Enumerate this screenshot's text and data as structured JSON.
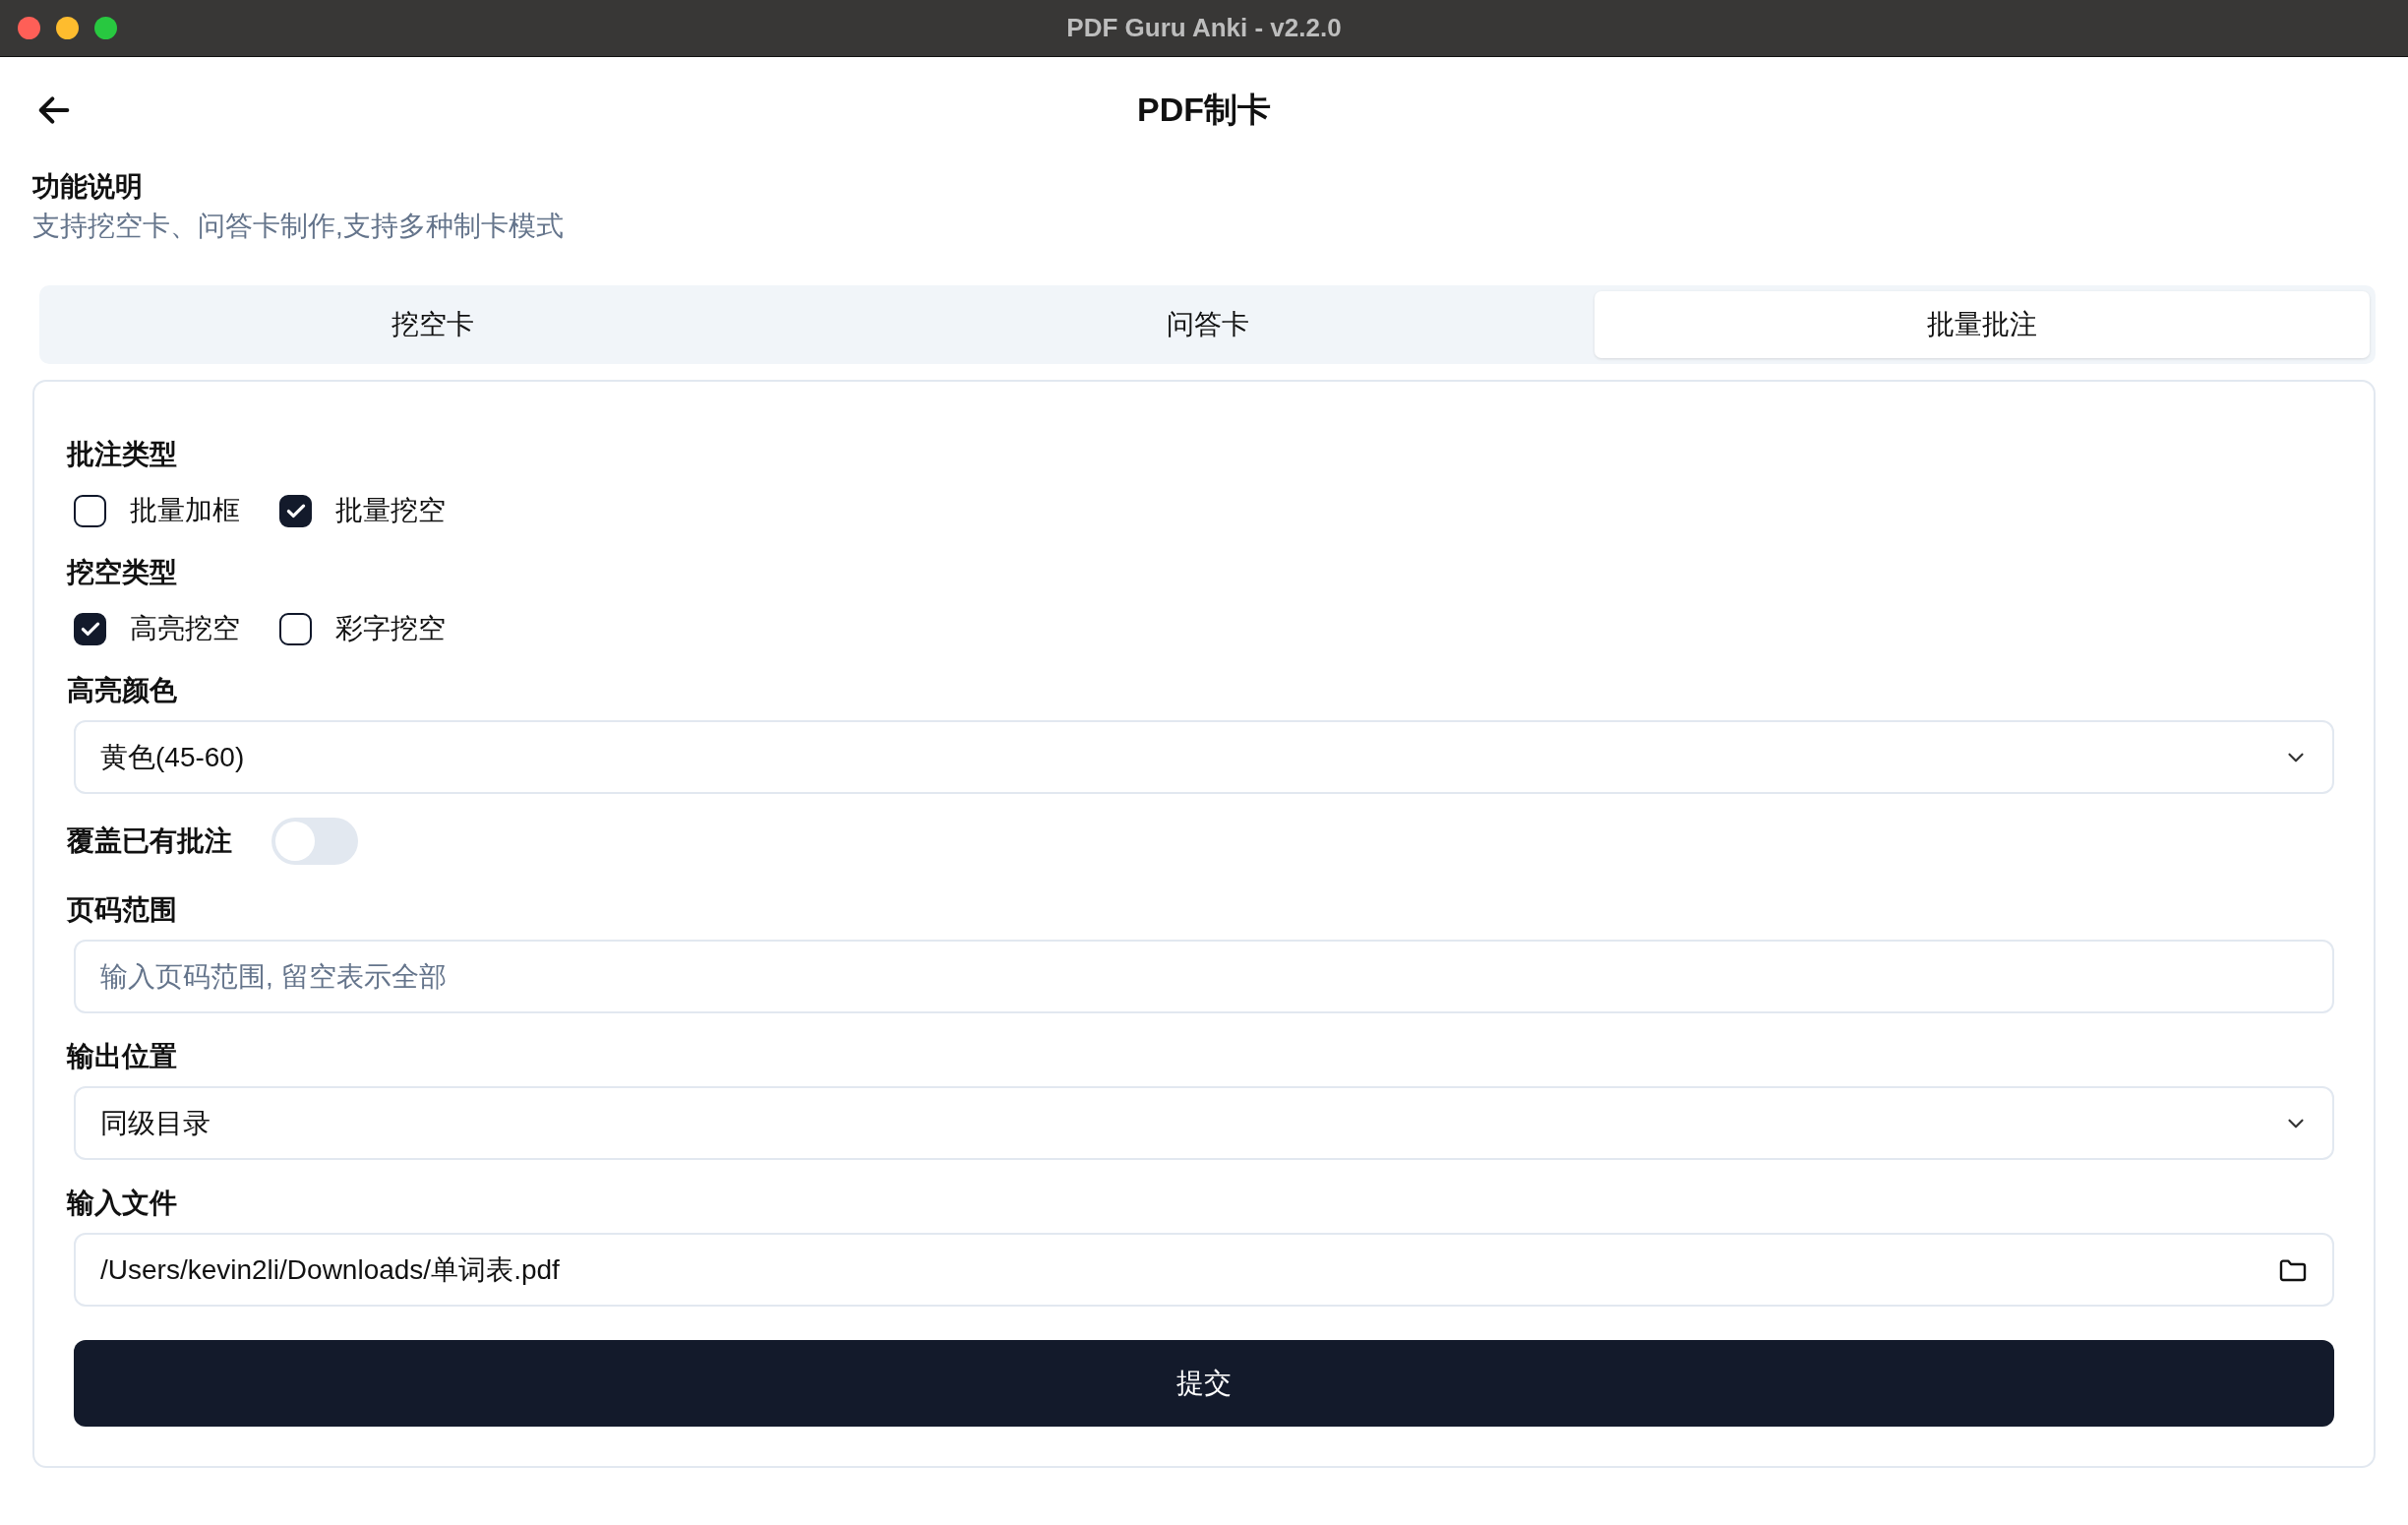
{
  "window": {
    "title": "PDF Guru Anki - v2.2.0"
  },
  "header": {
    "title": "PDF制卡"
  },
  "description": {
    "heading": "功能说明",
    "text": "支持挖空卡、问答卡制作,支持多种制卡模式"
  },
  "tabs": [
    {
      "label": "挖空卡",
      "selected": false
    },
    {
      "label": "问答卡",
      "selected": false
    },
    {
      "label": "批量批注",
      "selected": true
    }
  ],
  "form": {
    "fields": [
      {
        "kind": "checkgroup",
        "label": "批注类型",
        "options": [
          {
            "label": "批量加框",
            "checked": false
          },
          {
            "label": "批量挖空",
            "checked": true
          }
        ]
      },
      {
        "kind": "checkgroup",
        "label": "挖空类型",
        "options": [
          {
            "label": "高亮挖空",
            "checked": true
          },
          {
            "label": "彩字挖空",
            "checked": false
          }
        ]
      },
      {
        "kind": "select",
        "label": "高亮颜色",
        "value": "黄色(45-60)"
      },
      {
        "kind": "toggle",
        "label": "覆盖已有批注",
        "on": false
      },
      {
        "kind": "input",
        "label": "页码范围",
        "placeholder": "输入页码范围, 留空表示全部"
      },
      {
        "kind": "select",
        "label": "输出位置",
        "value": "同级目录"
      },
      {
        "kind": "file",
        "label": "输入文件",
        "value": "/Users/kevin2li/Downloads/单词表.pdf"
      }
    ],
    "submit": "提交"
  }
}
